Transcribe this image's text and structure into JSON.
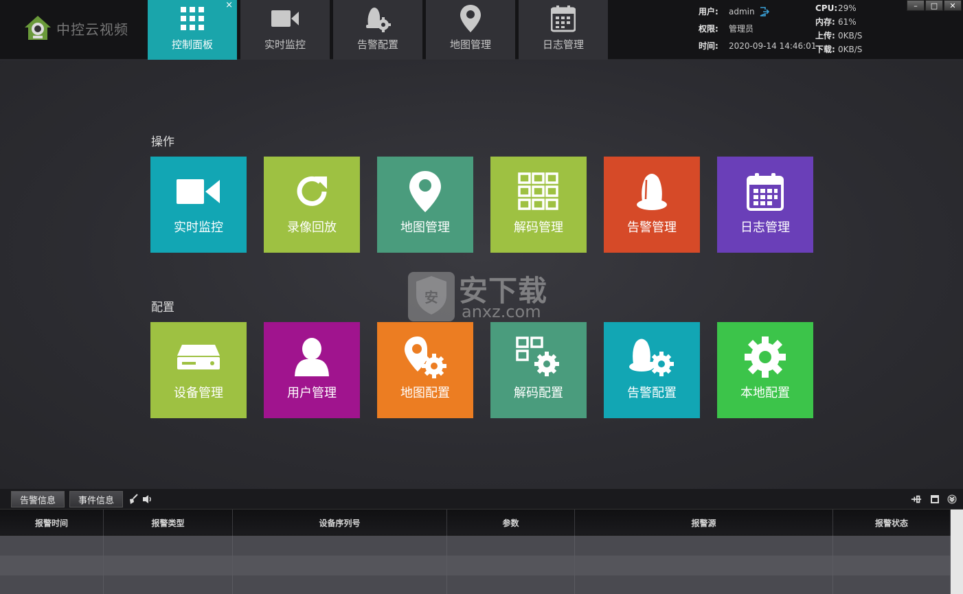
{
  "app": {
    "logo_text": "中控云视频"
  },
  "nav_tabs": [
    {
      "label": "控制面板",
      "icon": "dashboard-grid-icon",
      "active": true,
      "close": "×"
    },
    {
      "label": "实时监控",
      "icon": "video-camera-icon"
    },
    {
      "label": "告警配置",
      "icon": "alarm-config-icon"
    },
    {
      "label": "地图管理",
      "icon": "map-pin-icon"
    },
    {
      "label": "日志管理",
      "icon": "calendar-icon"
    }
  ],
  "status": {
    "user_label": "用户:",
    "user_value": "admin",
    "role_label": "权限:",
    "role_value": "管理员",
    "time_label": "时间:",
    "time_value": "2020-09-14 14:46:01",
    "cpu_label": "CPU:",
    "cpu_value": "29%",
    "mem_label": "内存:",
    "mem_value": "61%",
    "up_label": "上传:",
    "up_value": "0KB/S",
    "down_label": "下载:",
    "down_value": "0KB/S"
  },
  "window_controls": {
    "minimize": "–",
    "maximize": "□",
    "close": "✕"
  },
  "sections": {
    "operation_title": "操作",
    "config_title": "配置"
  },
  "operation_tiles": [
    {
      "label": "实时监控",
      "color": "#12a6b4",
      "icon": "video-camera-icon"
    },
    {
      "label": "录像回放",
      "color": "#9ec142",
      "icon": "refresh-icon"
    },
    {
      "label": "地图管理",
      "color": "#4a9c7d",
      "icon": "map-pin-icon"
    },
    {
      "label": "解码管理",
      "color": "#9ec142",
      "icon": "grid-3x3-icon"
    },
    {
      "label": "告警管理",
      "color": "#d64a28",
      "icon": "alarm-bell-icon"
    },
    {
      "label": "日志管理",
      "color": "#6a3fb8",
      "icon": "calendar-icon"
    }
  ],
  "config_tiles": [
    {
      "label": "设备管理",
      "color": "#9ec142",
      "icon": "device-drive-icon"
    },
    {
      "label": "用户管理",
      "color": "#a0148e",
      "icon": "user-icon"
    },
    {
      "label": "地图配置",
      "color": "#ec7d22",
      "icon": "map-gear-icon"
    },
    {
      "label": "解码配置",
      "color": "#4a9c7d",
      "icon": "grid-gear-icon"
    },
    {
      "label": "告警配置",
      "color": "#12a6b4",
      "icon": "alarm-gear-icon"
    },
    {
      "label": "本地配置",
      "color": "#3cc44a",
      "icon": "gear-icon"
    }
  ],
  "watermark": {
    "text": "安下载",
    "sub": "anxz.com",
    "shield": "安"
  },
  "bottom_tabs": [
    {
      "label": "告警信息",
      "active": true
    },
    {
      "label": "事件信息",
      "active": false
    }
  ],
  "table": {
    "columns": [
      "报警时间",
      "报警类型",
      "设备序列号",
      "参数",
      "报警源",
      "报警状态"
    ],
    "rows": [
      [
        "",
        "",
        "",
        "",
        "",
        ""
      ],
      [
        "",
        "",
        "",
        "",
        "",
        ""
      ],
      [
        "",
        "",
        "",
        "",
        "",
        ""
      ]
    ]
  }
}
